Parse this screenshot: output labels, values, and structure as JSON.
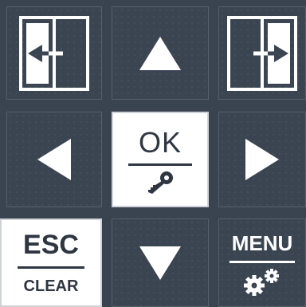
{
  "keypad": {
    "ok_label": "OK",
    "esc_label": "ESC",
    "clear_label": "CLEAR",
    "menu_label": "MENU",
    "keys": [
      {
        "name": "door-left-key",
        "icon": "door-left-arrow-icon"
      },
      {
        "name": "up-key",
        "icon": "triangle-up-icon"
      },
      {
        "name": "door-right-key",
        "icon": "door-right-arrow-icon"
      },
      {
        "name": "left-key",
        "icon": "triangle-left-icon"
      },
      {
        "name": "ok-key",
        "icon": "key-icon"
      },
      {
        "name": "right-key",
        "icon": "triangle-right-icon"
      },
      {
        "name": "esc-clear-key"
      },
      {
        "name": "down-key",
        "icon": "triangle-down-icon"
      },
      {
        "name": "menu-key",
        "icon": "gears-icon"
      }
    ]
  },
  "colors": {
    "background": "#3a4350",
    "dark_key": "#3b4552",
    "light_key": "#ffffff",
    "text_dark": "#2e3642",
    "text_light": "#ffffff"
  }
}
